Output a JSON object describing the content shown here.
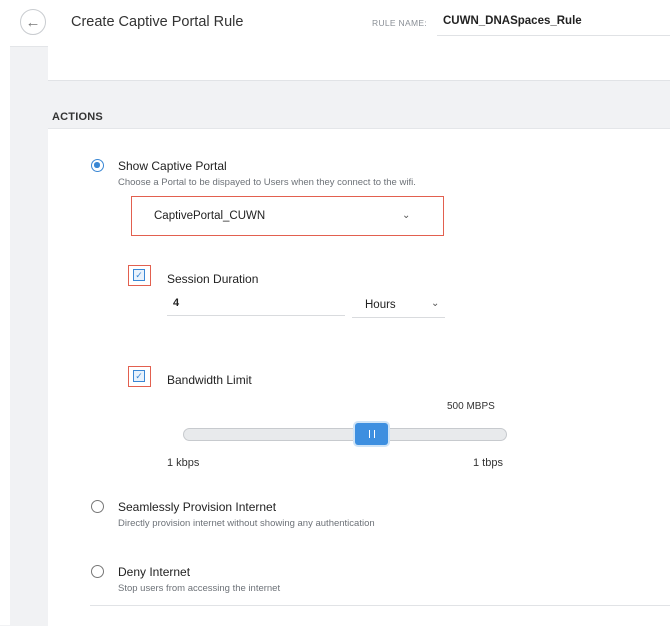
{
  "header": {
    "title": "Create Captive Portal Rule",
    "rule_name_label": "RULE NAME:",
    "rule_name_value": "CUWN_DNASpaces_Rule",
    "back_icon": "arrow-left-icon"
  },
  "actions": {
    "heading": "ACTIONS",
    "show_portal": {
      "title": "Show Captive Portal",
      "description": "Choose a Portal to be dispayed to Users when they connect to the wifi.",
      "selected": true,
      "portal_value": "CaptivePortal_CUWN",
      "session_duration": {
        "label": "Session Duration",
        "checked": true,
        "value": "4",
        "unit": "Hours"
      },
      "bandwidth_limit": {
        "label": "Bandwidth Limit",
        "checked": true,
        "current": "500 MBPS",
        "min": "1 kbps",
        "max": "1 tbps",
        "position_fraction": 0.55
      }
    },
    "provision": {
      "title": "Seamlessly Provision Internet",
      "description": "Directly provision internet without showing any authentication",
      "selected": false
    },
    "deny": {
      "title": "Deny Internet",
      "description": "Stop users from accessing the internet",
      "selected": false
    }
  },
  "colors": {
    "accent": "#3a87d4",
    "highlight_border": "#e2604f",
    "slider_thumb": "#3d8fe0"
  }
}
